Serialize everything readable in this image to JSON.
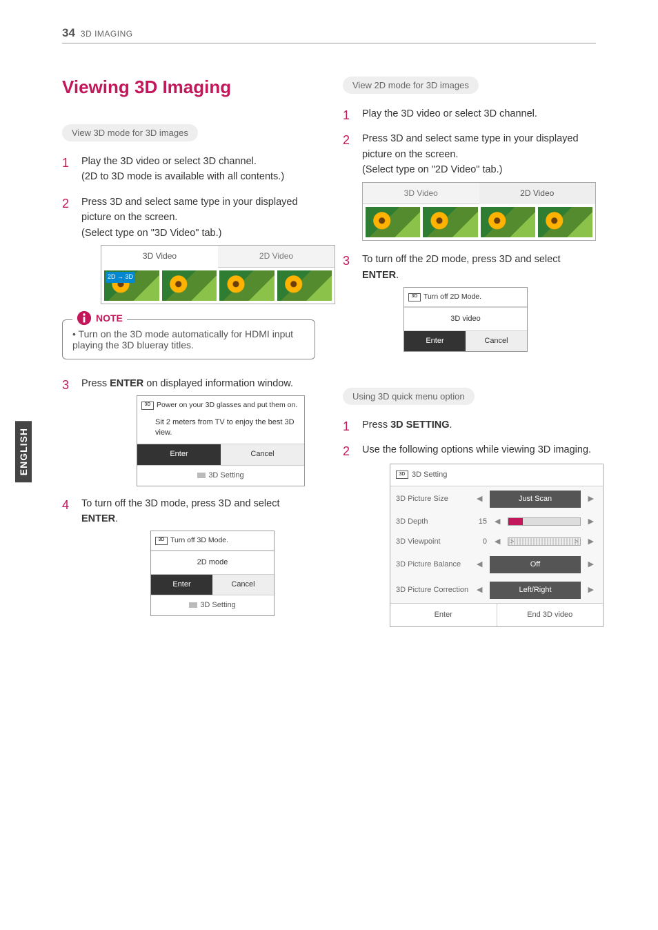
{
  "header": {
    "page": "34",
    "section": "3D IMAGING"
  },
  "side_tab": "ENGLISH",
  "title": "Viewing 3D Imaging",
  "left": {
    "pill": "View 3D mode for 3D images",
    "steps": {
      "s1a": "Play the 3D video or select 3D channel.",
      "s1b": "(2D to 3D mode is available with all contents.)",
      "s2a": "Press 3D and select same type in your displayed picture on the screen.",
      "s2b": "(Select type on \"3D Video\" tab.)",
      "tab_3d": "3D Video",
      "tab_2d": "2D Video",
      "note_label": "NOTE",
      "note_item": "Turn on the 3D mode automatically for HDMI input playing the 3D blueray titles.",
      "s3_pre": "Press ",
      "s3_bold": "ENTER",
      "s3_post": " on displayed information window.",
      "dlg1_l1": "Power on your 3D glasses and put them on.",
      "dlg1_l2": "Sit 2 meters from TV to enjoy the best 3D",
      "dlg1_l3": "view.",
      "dlg1_enter": "Enter",
      "dlg1_cancel": "Cancel",
      "dlg1_foot": "3D Setting",
      "s4_pre": "To turn off the 3D mode, press 3D and select ",
      "s4_bold": "ENTER",
      "s4_post": ".",
      "dlg2_hdr": "Turn off 3D Mode.",
      "dlg2_mid": "2D mode",
      "dlg2_enter": "Enter",
      "dlg2_cancel": "Cancel",
      "dlg2_foot": "3D Setting"
    }
  },
  "right": {
    "pill1": "View 2D mode for 3D images",
    "a": {
      "s1": "Play the 3D video or select 3D channel.",
      "s2a": "Press 3D and select same type in your displayed picture on the screen.",
      "s2b": "(Select type on \"2D Video\" tab.)",
      "tab_3d": "3D Video",
      "tab_2d": "2D Video",
      "s3_pre": "To turn off the 2D mode, press 3D and select ",
      "s3_bold": "ENTER",
      "s3_post": ".",
      "dlg_hdr": "Turn off 2D Mode.",
      "dlg_mid": "3D video",
      "dlg_enter": "Enter",
      "dlg_cancel": "Cancel"
    },
    "pill2": "Using 3D quick menu option",
    "b": {
      "s1_pre": "Press ",
      "s1_bold": "3D SETTING",
      "s1_post": ".",
      "s2": "Use the following options while viewing 3D imaging.",
      "panel_title": "3D Setting",
      "rows": {
        "size_label": "3D Picture Size",
        "size_value": "Just Scan",
        "depth_label": "3D Depth",
        "depth_value": "15",
        "view_label": "3D Viewpoint",
        "view_value": "0",
        "bal_label": "3D Picture Balance",
        "bal_value": "Off",
        "corr_label": "3D Picture Correction",
        "corr_value": "Left/Right"
      },
      "panel_enter": "Enter",
      "panel_end": "End 3D video"
    }
  }
}
